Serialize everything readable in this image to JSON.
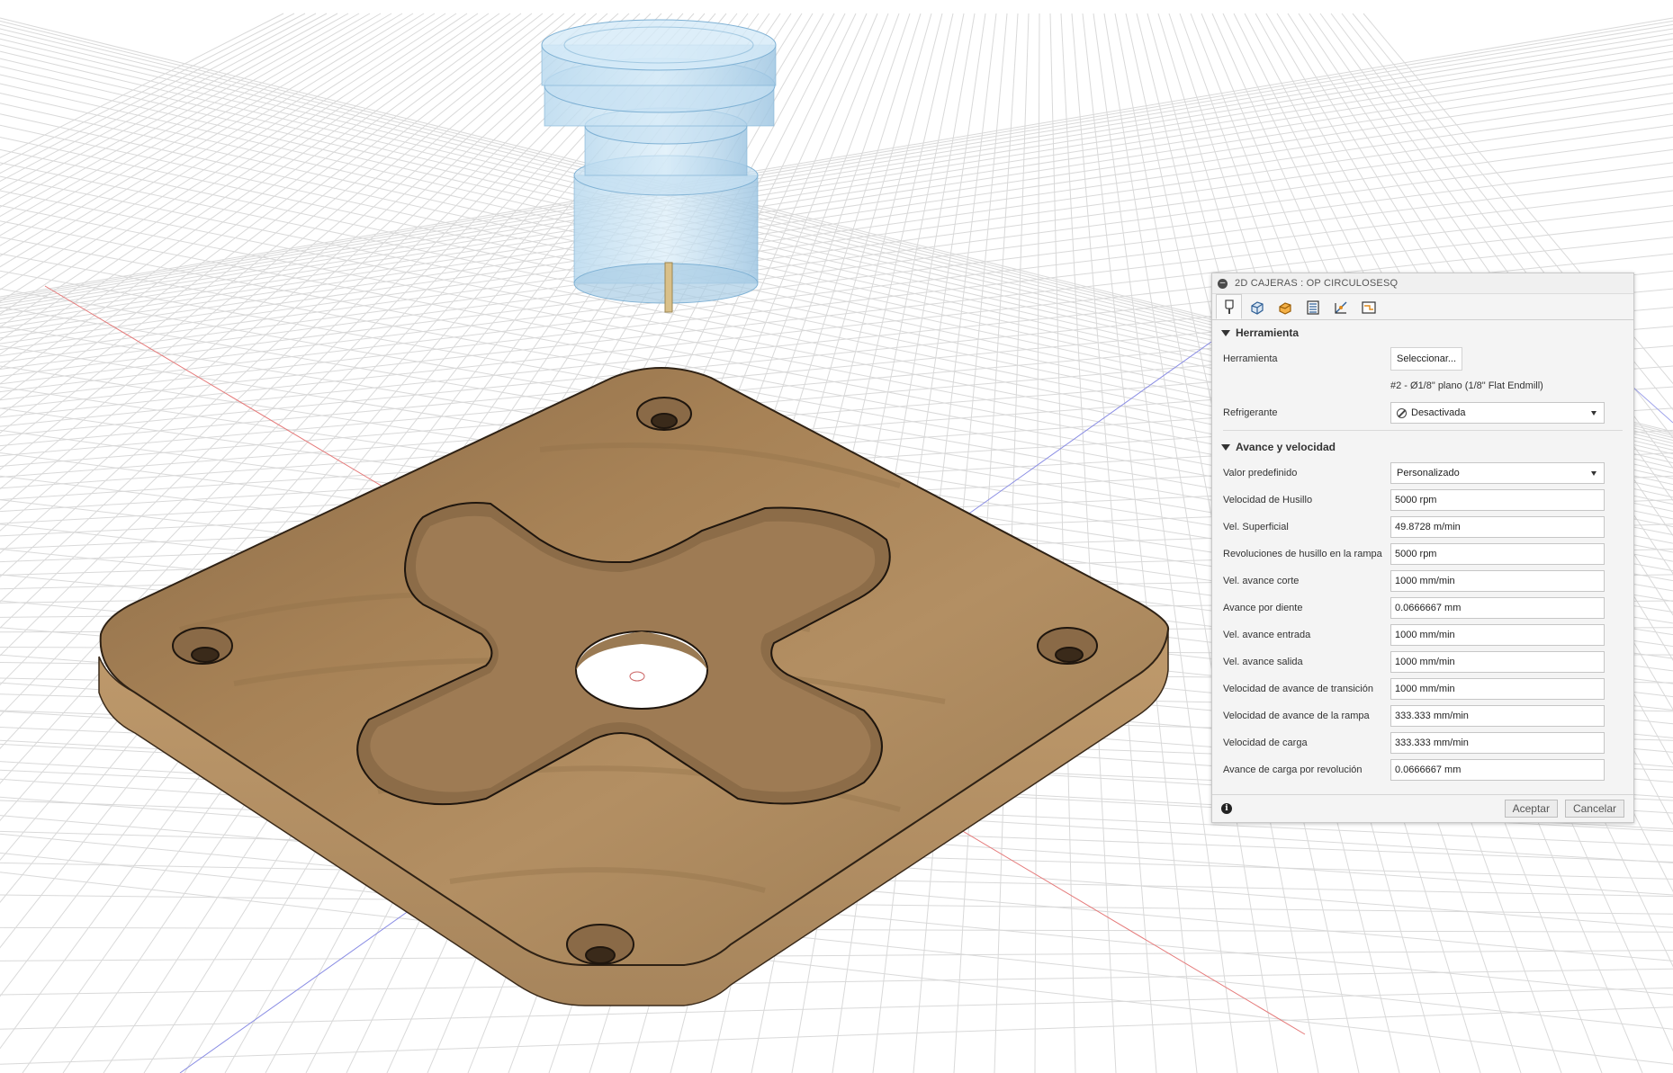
{
  "dialog": {
    "title": "2D CAJERAS : OP CIRCULOSESQ",
    "tabs": [
      {
        "icon": "tool-icon"
      },
      {
        "icon": "geometry-icon"
      },
      {
        "icon": "heights-icon"
      },
      {
        "icon": "passes-icon"
      },
      {
        "icon": "linking-icon"
      },
      {
        "icon": "post-icon"
      }
    ],
    "section_tool": {
      "header": "Herramienta",
      "tool_label": "Herramienta",
      "select_button": "Seleccionar...",
      "tool_description": "#2 - Ø1/8\" plano (1/8\" Flat Endmill)",
      "coolant_label": "Refrigerante",
      "coolant_value": "Desactivada"
    },
    "section_feed": {
      "header": "Avance y velocidad",
      "preset_label": "Valor predefinido",
      "preset_value": "Personalizado",
      "rows": [
        {
          "label": "Velocidad de Husillo",
          "value": "5000 rpm"
        },
        {
          "label": "Vel. Superficial",
          "value": "49.8728 m/min"
        },
        {
          "label": "Revoluciones de husillo en la rampa",
          "value": "5000 rpm"
        },
        {
          "label": "Vel. avance corte",
          "value": "1000 mm/min"
        },
        {
          "label": "Avance por diente",
          "value": "0.0666667 mm"
        },
        {
          "label": "Vel. avance entrada",
          "value": "1000 mm/min"
        },
        {
          "label": "Vel. avance salida",
          "value": "1000 mm/min"
        },
        {
          "label": "Velocidad de avance de transición",
          "value": "1000 mm/min"
        },
        {
          "label": "Velocidad de avance de la rampa",
          "value": "333.333 mm/min"
        },
        {
          "label": "Velocidad de carga",
          "value": "333.333 mm/min"
        },
        {
          "label": "Avance de carga por revolución",
          "value": "0.0666667 mm"
        }
      ]
    },
    "footer": {
      "ok": "Aceptar",
      "cancel": "Cancelar"
    }
  },
  "colors": {
    "wood_top": "#a98459",
    "wood_side": "#b08c61",
    "grid": "#d6d6d6",
    "axis_red": "#e57a7a",
    "axis_blue": "#7b7ee0",
    "tool_holder": "#a9cde6"
  }
}
